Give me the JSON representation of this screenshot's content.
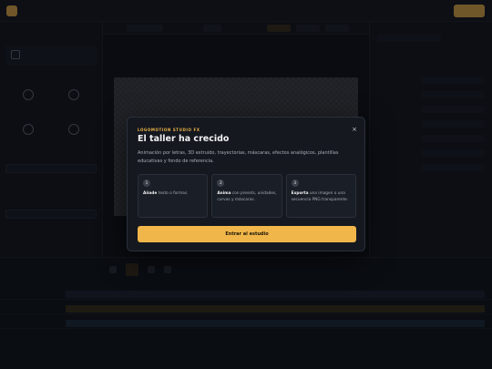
{
  "modal": {
    "eyebrow": "LOGOMOTION STUDIO FX",
    "title": "El taller ha crecido",
    "description": "Animación por letras, 3D extruido, trayectorias, máscaras, efectos analógicos, plantillas educativas y fondo de referencia.",
    "steps": [
      {
        "number": "1",
        "action": "Añade",
        "rest": " texto o formas."
      },
      {
        "number": "2",
        "action": "Anima",
        "rest": " con presets, unidades, curvas y máscaras."
      },
      {
        "number": "3",
        "action": "Exporta",
        "rest": " una imagen o una secuencia PNG transparente."
      }
    ],
    "cta_label": "Entrar al estudio",
    "close_glyph": "×"
  },
  "colors": {
    "accent": "#f0b64a",
    "modal_bg": "#15181f",
    "page_bg": "#0c0e13"
  },
  "icons": [
    "close-icon",
    "play-icon",
    "shape-icons"
  ]
}
